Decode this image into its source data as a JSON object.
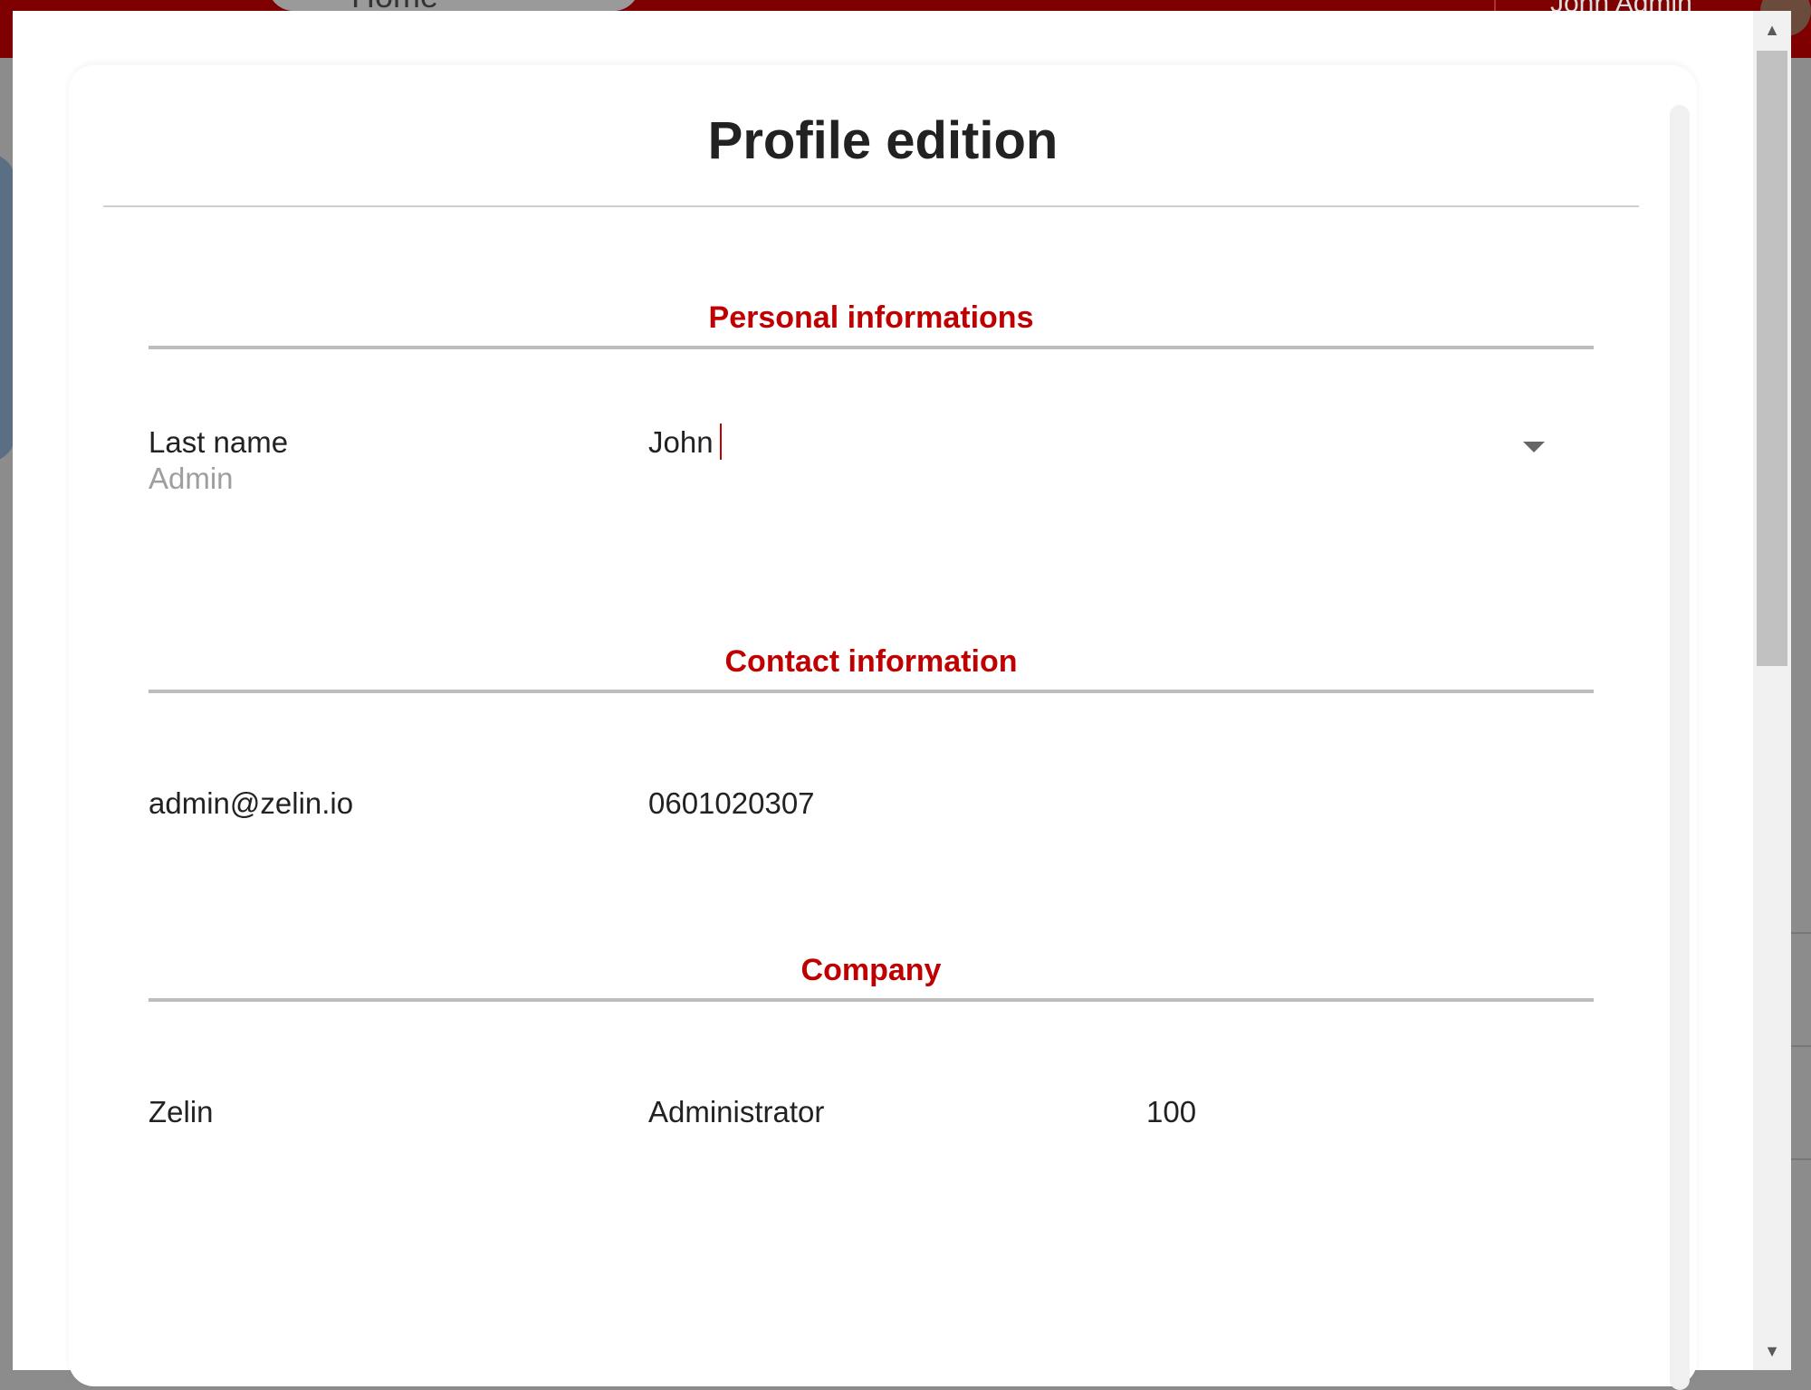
{
  "background": {
    "nav_home": "Home",
    "user_name": "John Admin"
  },
  "dialog": {
    "title": "Profile edition",
    "sections": {
      "personal": {
        "title": "Personal informations",
        "last_name_label": "Last name",
        "last_name_value": "Admin",
        "first_name_value": "John"
      },
      "contact": {
        "title": "Contact information",
        "email": "admin@zelin.io",
        "phone": "0601020307"
      },
      "company": {
        "title": "Company",
        "company_name": "Zelin",
        "role": "Administrator",
        "number": "100"
      }
    }
  },
  "icons": {
    "dropdown": "chevron-down-icon",
    "scroll_up": "scroll-up-arrow-icon",
    "scroll_down": "scroll-down-arrow-icon"
  },
  "colors": {
    "accent": "#c00000",
    "topbar": "#7e0000"
  }
}
